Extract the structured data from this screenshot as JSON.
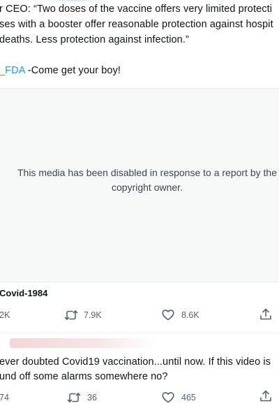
{
  "tweet": {
    "lines": [
      "r CEO: “Two doses of the vaccine offers very limited protecti",
      "ses with a booster offer reasonable protection against hospit",
      "deaths. Less protection against infection.”"
    ],
    "mention": "_FDA",
    "mention_rest": " -Come get your boy!"
  },
  "media": {
    "disabled_message": "This media has been disabled in response to a report by the copyright owner."
  },
  "quoted_author": "Covid-1984",
  "actions": {
    "replies": "2K",
    "retweets": "7.9K",
    "likes": "8.6K"
  },
  "reply_tweet": {
    "lines": [
      "ever doubted Covid19 vaccination...until now. If this video is",
      "und off some alarms somewhere no?"
    ],
    "actions": {
      "replies": "74",
      "retweets": "36",
      "likes": "465"
    }
  },
  "colors": {
    "accent": "#1d9bf0",
    "muted": "#536471",
    "media_bg": "#f7f9f9"
  }
}
